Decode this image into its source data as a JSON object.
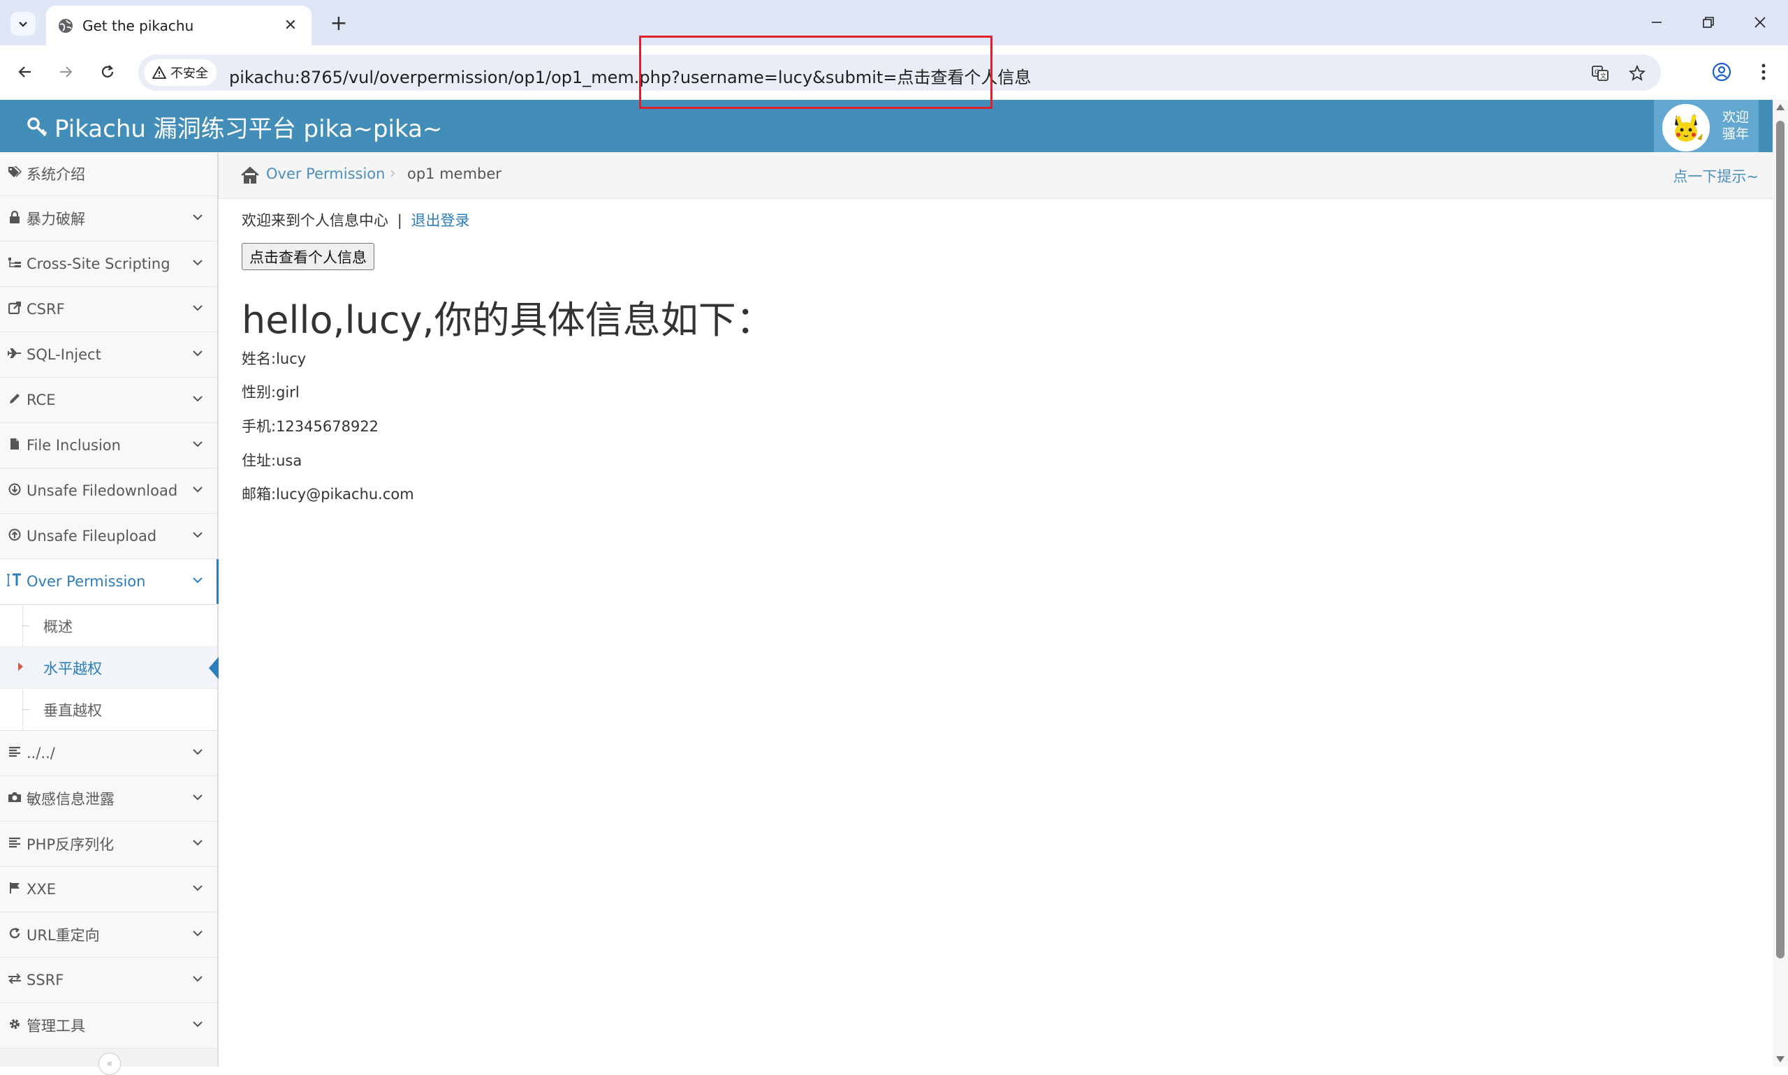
{
  "browser": {
    "tab_title": "Get the pikachu",
    "security_label": "不安全",
    "url": "pikachu:8765/vul/overpermission/op1/op1_mem.php?username=lucy&submit=点击查看个人信息"
  },
  "header": {
    "brand": "Pikachu 漏洞练习平台 pika~pika~",
    "welcome_line1": "欢迎",
    "welcome_line2": "骚年"
  },
  "sidebar": {
    "items": [
      {
        "label": "系统介绍",
        "icon": "tags-icon"
      },
      {
        "label": "暴力破解",
        "icon": "lock-icon"
      },
      {
        "label": "Cross-Site Scripting",
        "icon": "sitemap-icon"
      },
      {
        "label": "CSRF",
        "icon": "external-link-icon"
      },
      {
        "label": "SQL-Inject",
        "icon": "plane-icon"
      },
      {
        "label": "RCE",
        "icon": "pencil-icon"
      },
      {
        "label": "File Inclusion",
        "icon": "file-icon"
      },
      {
        "label": "Unsafe Filedownload",
        "icon": "download-icon"
      },
      {
        "label": "Unsafe Fileupload",
        "icon": "upload-icon"
      },
      {
        "label": "Over Permission",
        "icon": "text-height-icon"
      },
      {
        "label": "../../",
        "icon": "align-left-icon"
      },
      {
        "label": "敏感信息泄露",
        "icon": "camera-icon"
      },
      {
        "label": "PHP反序列化",
        "icon": "align-left-icon"
      },
      {
        "label": "XXE",
        "icon": "flag-icon"
      },
      {
        "label": "URL重定向",
        "icon": "refresh-icon"
      },
      {
        "label": "SSRF",
        "icon": "exchange-icon"
      },
      {
        "label": "管理工具",
        "icon": "cog-icon"
      }
    ],
    "submenu": [
      "概述",
      "水平越权",
      "垂直越权"
    ]
  },
  "breadcrumb": {
    "parent": "Over Permission",
    "current": "op1 member",
    "hint": "点一下提示~"
  },
  "main": {
    "welcome_text": "欢迎来到个人信息中心",
    "separator": "|",
    "logout": "退出登录",
    "button": "点击查看个人信息",
    "greeting": "hello,lucy,你的具体信息如下：",
    "info": [
      "姓名:lucy",
      "性别:girl",
      "手机:12345678922",
      "住址:usa",
      "邮箱:lucy@pikachu.com"
    ]
  },
  "colors": {
    "header_blue": "#438eb9",
    "link_blue": "#2b7dbc",
    "highlight_red": "#e0202e"
  }
}
